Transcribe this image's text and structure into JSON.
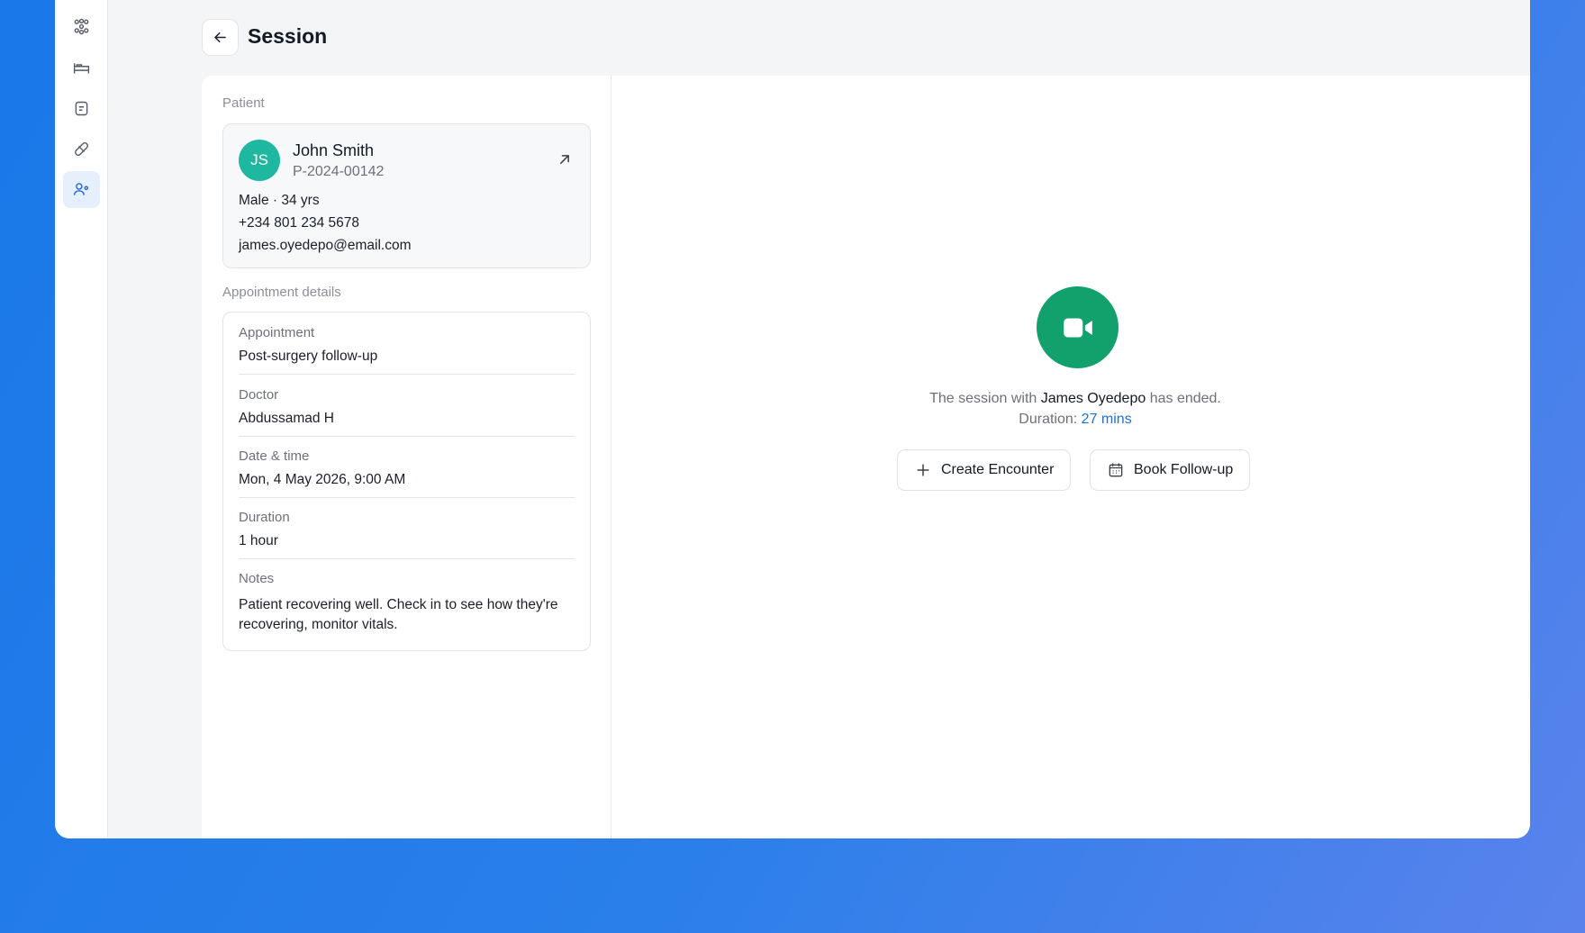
{
  "header": {
    "title": "Session"
  },
  "patient": {
    "section_label": "Patient",
    "initials": "JS",
    "name": "John Smith",
    "id": "P-2024-00142",
    "demographics": "Male · 34 yrs",
    "phone": "+234 801 234 5678",
    "email": "james.oyedepo@email.com"
  },
  "appointment": {
    "section_label": "Appointment details",
    "rows": [
      {
        "label": "Appointment",
        "value": "Post-surgery follow-up"
      },
      {
        "label": "Doctor",
        "value": "Abdussamad H"
      },
      {
        "label": "Date & time",
        "value": "Mon, 4 May 2026, 9:00 AM"
      },
      {
        "label": "Duration",
        "value": "1 hour"
      },
      {
        "label": "Notes",
        "value": "Patient recovering well. Check in to see how they're recovering, monitor vitals."
      }
    ]
  },
  "session": {
    "message_prefix": "The session with ",
    "participant": "James Oyedepo",
    "message_suffix": " has ended.",
    "duration_label": "Duration: ",
    "duration_value": "27 mins",
    "create_encounter_label": "Create Encounter",
    "book_followup_label": "Book Follow-up"
  },
  "colors": {
    "accent": "#1f6fd6",
    "avatar": "#1eb7a0",
    "video_circle": "#12a06c"
  },
  "icons": [
    "network-icon",
    "bed-icon",
    "note-icon",
    "pill-icon",
    "user-settings-icon",
    "arrow-left-icon",
    "external-link-icon",
    "video-camera-icon",
    "plus-icon",
    "calendar-icon"
  ]
}
